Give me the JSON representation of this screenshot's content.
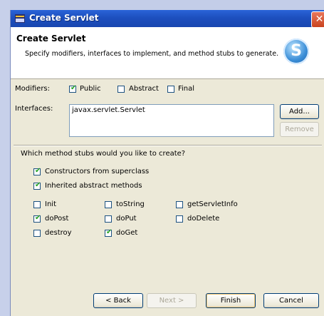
{
  "window": {
    "title": "Create Servlet"
  },
  "header": {
    "title": "Create Servlet",
    "description": "Specify modifiers, interfaces to implement, and method stubs to generate.",
    "logo_letter": "S"
  },
  "modifiers": {
    "label": "Modifiers:",
    "options": [
      {
        "label": "Public",
        "checked": true
      },
      {
        "label": "Abstract",
        "checked": false
      },
      {
        "label": "Final",
        "checked": false
      }
    ]
  },
  "interfaces": {
    "label": "Interfaces:",
    "items": [
      "javax.servlet.Servlet"
    ],
    "add_label": "Add...",
    "remove_label": "Remove"
  },
  "stubs": {
    "question": "Which method stubs would you like to create?",
    "constructors": {
      "label": "Constructors from superclass",
      "checked": true
    },
    "inherited": {
      "label": "Inherited abstract methods",
      "checked": true
    },
    "methods": [
      {
        "label": "Init",
        "checked": false
      },
      {
        "label": "toString",
        "checked": false
      },
      {
        "label": "getServletInfo",
        "checked": false
      },
      {
        "label": "doPost",
        "checked": true
      },
      {
        "label": "doPut",
        "checked": false
      },
      {
        "label": "doDelete",
        "checked": false
      },
      {
        "label": "destroy",
        "checked": false
      },
      {
        "label": "doGet",
        "checked": true
      }
    ]
  },
  "footer": {
    "back_label": "< Back",
    "next_label": "Next >",
    "finish_label": "Finish",
    "cancel_label": "Cancel"
  },
  "colors": {
    "titlebar": "#1d4fbe",
    "dialog_bg": "#ece9d8",
    "check": "#21a121"
  }
}
